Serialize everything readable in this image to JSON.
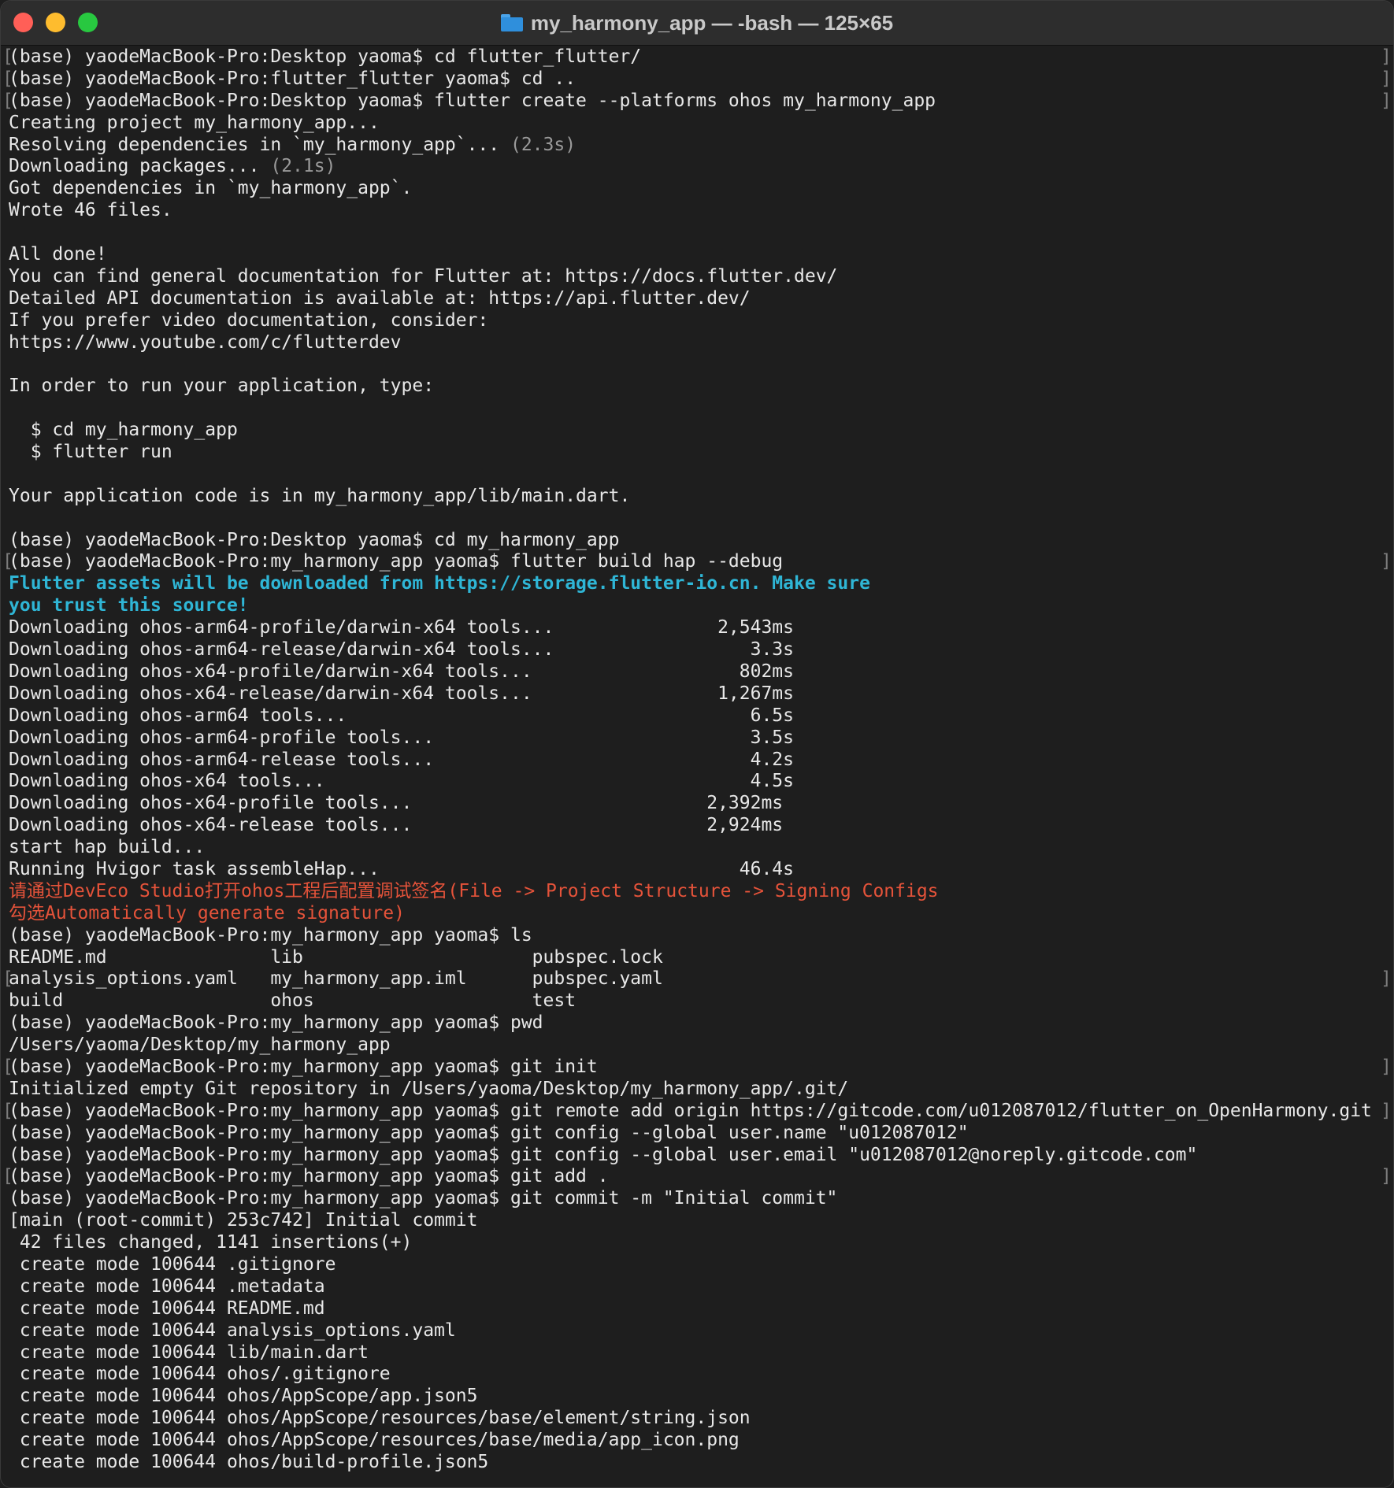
{
  "window": {
    "title": "my_harmony_app — -bash — 125×65"
  },
  "terminal": {
    "lines": [
      {
        "text": "(base) yaodeMacBook-Pro:Desktop yaoma$ cd flutter_flutter/",
        "style": "",
        "mark": true
      },
      {
        "text": "(base) yaodeMacBook-Pro:flutter_flutter yaoma$ cd ..",
        "style": "",
        "mark": true
      },
      {
        "text": "(base) yaodeMacBook-Pro:Desktop yaoma$ flutter create --platforms ohos my_harmony_app",
        "style": "",
        "mark": true
      },
      {
        "text": "Creating project my_harmony_app...",
        "style": ""
      },
      {
        "text": "Resolving dependencies in `my_harmony_app`...",
        "suffix": " (2.3s)",
        "style": ""
      },
      {
        "text": "Downloading packages...",
        "suffix": " (2.1s)",
        "style": ""
      },
      {
        "text": "Got dependencies in `my_harmony_app`.",
        "style": ""
      },
      {
        "text": "Wrote 46 files.",
        "style": ""
      },
      {
        "text": "",
        "style": ""
      },
      {
        "text": "All done!",
        "style": ""
      },
      {
        "text": "You can find general documentation for Flutter at: https://docs.flutter.dev/",
        "style": ""
      },
      {
        "text": "Detailed API documentation is available at: https://api.flutter.dev/",
        "style": ""
      },
      {
        "text": "If you prefer video documentation, consider:",
        "style": ""
      },
      {
        "text": "https://www.youtube.com/c/flutterdev",
        "style": ""
      },
      {
        "text": "",
        "style": ""
      },
      {
        "text": "In order to run your application, type:",
        "style": ""
      },
      {
        "text": "",
        "style": ""
      },
      {
        "text": "  $ cd my_harmony_app",
        "style": ""
      },
      {
        "text": "  $ flutter run",
        "style": ""
      },
      {
        "text": "",
        "style": ""
      },
      {
        "text": "Your application code is in my_harmony_app/lib/main.dart.",
        "style": ""
      },
      {
        "text": "",
        "style": ""
      },
      {
        "text": "(base) yaodeMacBook-Pro:Desktop yaoma$ cd my_harmony_app",
        "style": ""
      },
      {
        "text": "(base) yaodeMacBook-Pro:my_harmony_app yaoma$ flutter build hap --debug",
        "style": "",
        "mark": true
      },
      {
        "text": "Flutter assets will be downloaded from https://storage.flutter-io.cn. Make sure",
        "style": "cyan"
      },
      {
        "text": "you trust this source!",
        "style": "cyan"
      },
      {
        "text": "Downloading ohos-arm64-profile/darwin-x64 tools...               2,543ms",
        "style": ""
      },
      {
        "text": "Downloading ohos-arm64-release/darwin-x64 tools...                  3.3s",
        "style": ""
      },
      {
        "text": "Downloading ohos-x64-profile/darwin-x64 tools...                   802ms",
        "style": ""
      },
      {
        "text": "Downloading ohos-x64-release/darwin-x64 tools...                 1,267ms",
        "style": ""
      },
      {
        "text": "Downloading ohos-arm64 tools...                                     6.5s",
        "style": ""
      },
      {
        "text": "Downloading ohos-arm64-profile tools...                             3.5s",
        "style": ""
      },
      {
        "text": "Downloading ohos-arm64-release tools...                             4.2s",
        "style": ""
      },
      {
        "text": "Downloading ohos-x64 tools...                                       4.5s",
        "style": ""
      },
      {
        "text": "Downloading ohos-x64-profile tools...                           2,392ms",
        "style": ""
      },
      {
        "text": "Downloading ohos-x64-release tools...                           2,924ms",
        "style": ""
      },
      {
        "text": "start hap build...",
        "style": ""
      },
      {
        "text": "Running Hvigor task assembleHap...                                 46.4s",
        "style": ""
      },
      {
        "text": "请通过DevEco Studio打开ohos工程后配置调试签名(File -> Project Structure -> Signing Configs",
        "style": "red"
      },
      {
        "text": "勾选Automatically generate signature)",
        "style": "red"
      },
      {
        "text": "(base) yaodeMacBook-Pro:my_harmony_app yaoma$ ls",
        "style": ""
      },
      {
        "text": "README.md               lib                     pubspec.lock",
        "style": ""
      },
      {
        "text": "analysis_options.yaml   my_harmony_app.iml      pubspec.yaml",
        "style": "",
        "mark": true
      },
      {
        "text": "build                   ohos                    test",
        "style": ""
      },
      {
        "text": "(base) yaodeMacBook-Pro:my_harmony_app yaoma$ pwd",
        "style": ""
      },
      {
        "text": "/Users/yaoma/Desktop/my_harmony_app",
        "style": ""
      },
      {
        "text": "(base) yaodeMacBook-Pro:my_harmony_app yaoma$ git init",
        "style": "",
        "mark": true
      },
      {
        "text": "Initialized empty Git repository in /Users/yaoma/Desktop/my_harmony_app/.git/",
        "style": ""
      },
      {
        "text": "(base) yaodeMacBook-Pro:my_harmony_app yaoma$ git remote add origin https://gitcode.com/u012087012/flutter_on_OpenHarmony.git",
        "style": "",
        "mark": true
      },
      {
        "text": "(base) yaodeMacBook-Pro:my_harmony_app yaoma$ git config --global user.name \"u012087012\"",
        "style": ""
      },
      {
        "text": "(base) yaodeMacBook-Pro:my_harmony_app yaoma$ git config --global user.email \"u012087012@noreply.gitcode.com\"",
        "style": ""
      },
      {
        "text": "(base) yaodeMacBook-Pro:my_harmony_app yaoma$ git add .",
        "style": "",
        "mark": true
      },
      {
        "text": "(base) yaodeMacBook-Pro:my_harmony_app yaoma$ git commit -m \"Initial commit\"",
        "style": ""
      },
      {
        "text": "[main (root-commit) 253c742] Initial commit",
        "style": ""
      },
      {
        "text": " 42 files changed, 1141 insertions(+)",
        "style": ""
      },
      {
        "text": " create mode 100644 .gitignore",
        "style": ""
      },
      {
        "text": " create mode 100644 .metadata",
        "style": ""
      },
      {
        "text": " create mode 100644 README.md",
        "style": ""
      },
      {
        "text": " create mode 100644 analysis_options.yaml",
        "style": ""
      },
      {
        "text": " create mode 100644 lib/main.dart",
        "style": ""
      },
      {
        "text": " create mode 100644 ohos/.gitignore",
        "style": ""
      },
      {
        "text": " create mode 100644 ohos/AppScope/app.json5",
        "style": ""
      },
      {
        "text": " create mode 100644 ohos/AppScope/resources/base/element/string.json",
        "style": ""
      },
      {
        "text": " create mode 100644 ohos/AppScope/resources/base/media/app_icon.png",
        "style": ""
      },
      {
        "text": " create mode 100644 ohos/build-profile.json5",
        "style": ""
      }
    ]
  }
}
